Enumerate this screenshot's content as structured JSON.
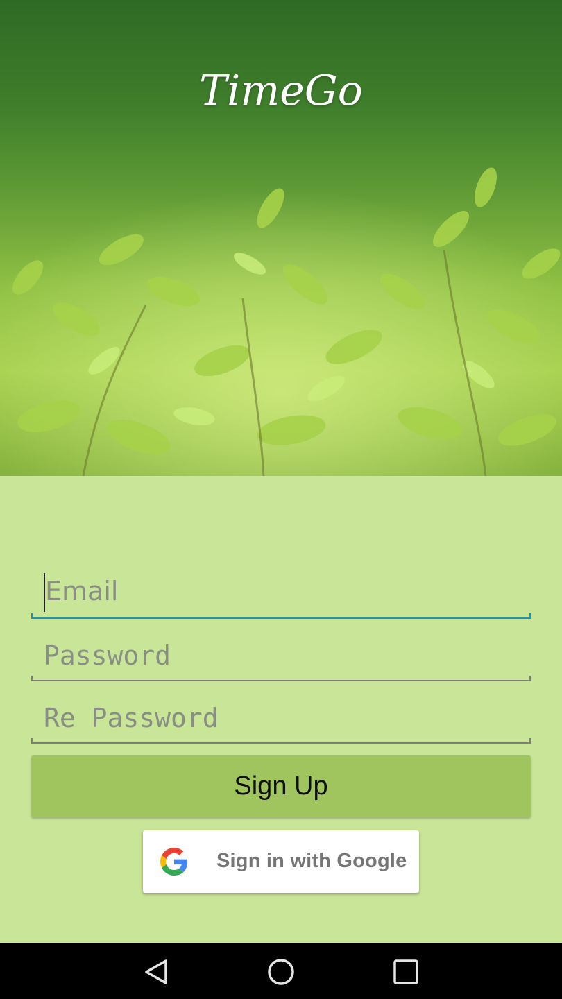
{
  "app": {
    "title": "TimeGo"
  },
  "form": {
    "email_placeholder": "Email",
    "password_placeholder": "Password",
    "repassword_placeholder": "Re Password",
    "signup_label": "Sign Up",
    "google_label": "Sign in with Google"
  },
  "icons": {
    "google": "google-g-icon",
    "back": "back-triangle-icon",
    "home": "home-circle-icon",
    "recents": "recents-square-icon"
  },
  "colors": {
    "panel_bg": "#c9e598",
    "signup_bg": "#a0c45e",
    "focus_underline": "#1f93b7",
    "navbar_bg": "#000000"
  }
}
